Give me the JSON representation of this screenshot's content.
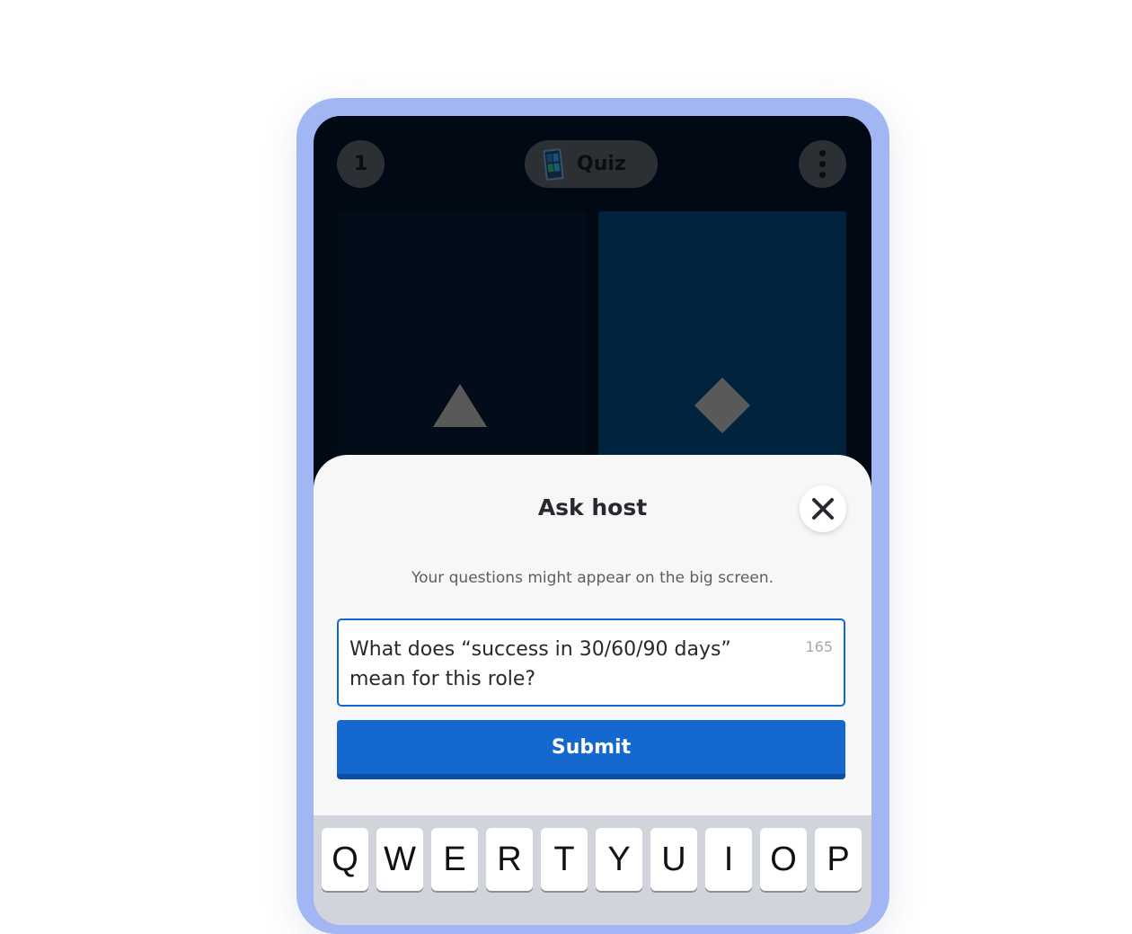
{
  "header": {
    "round_number": "1",
    "activity_label": "Quiz",
    "activity_icon": "quiz-icon",
    "more_icon": "more-vertical-icon"
  },
  "answer_cards": [
    {
      "shape": "triangle-icon",
      "color": "#020d19"
    },
    {
      "shape": "diamond-icon",
      "color": "#02233e"
    }
  ],
  "ask_host_sheet": {
    "title": "Ask host",
    "subtitle": "Your questions might appear on the big screen.",
    "question_value": "What does “success in 30/60/90 days” mean for this role?",
    "char_remaining": "165",
    "submit_label": "Submit",
    "close_icon": "close-icon",
    "accent_color": "#1468ce"
  },
  "keyboard": {
    "row1": [
      "Q",
      "W",
      "E",
      "R",
      "T",
      "Y",
      "U",
      "I",
      "O",
      "P"
    ]
  }
}
